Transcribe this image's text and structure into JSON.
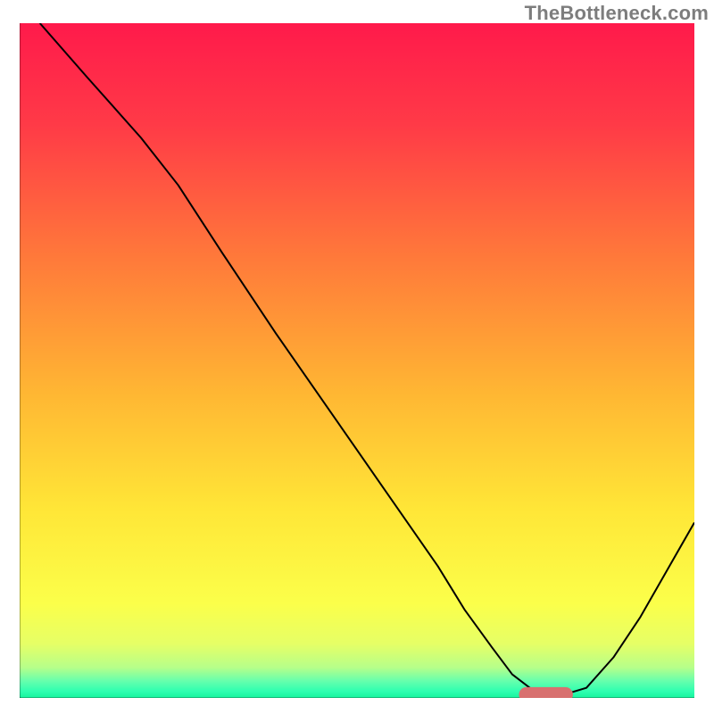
{
  "watermark": "TheBottleneck.com",
  "chart_data": {
    "type": "line",
    "title": "",
    "xlabel": "",
    "ylabel": "",
    "xlim": [
      0,
      100
    ],
    "ylim": [
      0,
      100
    ],
    "axes_visible": false,
    "grid": false,
    "spines": {
      "left": true,
      "bottom": true,
      "top": false,
      "right": false
    },
    "background": {
      "description": "vertical rainbow gradient, hot at top → cool at bottom, transitioning through red/orange/yellow with a thin green band at the base",
      "stops": [
        {
          "pos": 0.0,
          "color": "#ff1a4b"
        },
        {
          "pos": 0.15,
          "color": "#ff3a47"
        },
        {
          "pos": 0.35,
          "color": "#ff7a3a"
        },
        {
          "pos": 0.55,
          "color": "#ffb733"
        },
        {
          "pos": 0.72,
          "color": "#ffe637"
        },
        {
          "pos": 0.86,
          "color": "#fbff4a"
        },
        {
          "pos": 0.92,
          "color": "#e6ff66"
        },
        {
          "pos": 0.955,
          "color": "#b6ff8a"
        },
        {
          "pos": 0.975,
          "color": "#66ffad"
        },
        {
          "pos": 0.99,
          "color": "#2fffb0"
        },
        {
          "pos": 1.0,
          "color": "#15f59e"
        }
      ]
    },
    "series": [
      {
        "name": "bottleneck-curve",
        "stroke": "#000000",
        "stroke_width": 2,
        "x": [
          3,
          10,
          18,
          23.5,
          30,
          38,
          46,
          54,
          62,
          66,
          70,
          73,
          76,
          80,
          84,
          88,
          92,
          96,
          100
        ],
        "y": [
          100,
          92,
          83,
          76,
          66,
          54,
          42.5,
          31,
          19.5,
          13,
          7.5,
          3.5,
          1.2,
          0.3,
          1.5,
          6,
          12,
          19,
          26
        ]
      }
    ],
    "marker": {
      "name": "optimal-range-bar",
      "shape": "rounded-rect",
      "fill": "#d8706f",
      "x_range": [
        74,
        82
      ],
      "y": 0.5,
      "height": 2.2
    }
  }
}
